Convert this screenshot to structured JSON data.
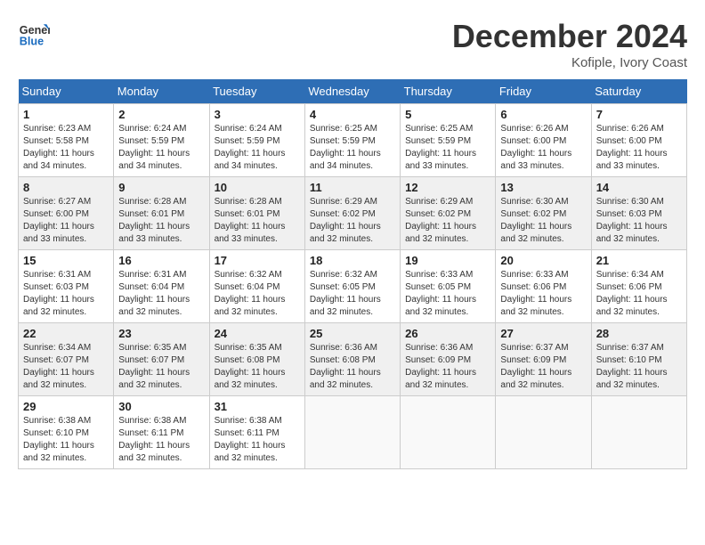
{
  "header": {
    "logo_text_general": "General",
    "logo_text_blue": "Blue",
    "month_title": "December 2024",
    "location": "Kofiple, Ivory Coast"
  },
  "weekdays": [
    "Sunday",
    "Monday",
    "Tuesday",
    "Wednesday",
    "Thursday",
    "Friday",
    "Saturday"
  ],
  "weeks": [
    [
      {
        "day": "1",
        "info": "Sunrise: 6:23 AM\nSunset: 5:58 PM\nDaylight: 11 hours\nand 34 minutes."
      },
      {
        "day": "2",
        "info": "Sunrise: 6:24 AM\nSunset: 5:59 PM\nDaylight: 11 hours\nand 34 minutes."
      },
      {
        "day": "3",
        "info": "Sunrise: 6:24 AM\nSunset: 5:59 PM\nDaylight: 11 hours\nand 34 minutes."
      },
      {
        "day": "4",
        "info": "Sunrise: 6:25 AM\nSunset: 5:59 PM\nDaylight: 11 hours\nand 34 minutes."
      },
      {
        "day": "5",
        "info": "Sunrise: 6:25 AM\nSunset: 5:59 PM\nDaylight: 11 hours\nand 33 minutes."
      },
      {
        "day": "6",
        "info": "Sunrise: 6:26 AM\nSunset: 6:00 PM\nDaylight: 11 hours\nand 33 minutes."
      },
      {
        "day": "7",
        "info": "Sunrise: 6:26 AM\nSunset: 6:00 PM\nDaylight: 11 hours\nand 33 minutes."
      }
    ],
    [
      {
        "day": "8",
        "info": "Sunrise: 6:27 AM\nSunset: 6:00 PM\nDaylight: 11 hours\nand 33 minutes."
      },
      {
        "day": "9",
        "info": "Sunrise: 6:28 AM\nSunset: 6:01 PM\nDaylight: 11 hours\nand 33 minutes."
      },
      {
        "day": "10",
        "info": "Sunrise: 6:28 AM\nSunset: 6:01 PM\nDaylight: 11 hours\nand 33 minutes."
      },
      {
        "day": "11",
        "info": "Sunrise: 6:29 AM\nSunset: 6:02 PM\nDaylight: 11 hours\nand 32 minutes."
      },
      {
        "day": "12",
        "info": "Sunrise: 6:29 AM\nSunset: 6:02 PM\nDaylight: 11 hours\nand 32 minutes."
      },
      {
        "day": "13",
        "info": "Sunrise: 6:30 AM\nSunset: 6:02 PM\nDaylight: 11 hours\nand 32 minutes."
      },
      {
        "day": "14",
        "info": "Sunrise: 6:30 AM\nSunset: 6:03 PM\nDaylight: 11 hours\nand 32 minutes."
      }
    ],
    [
      {
        "day": "15",
        "info": "Sunrise: 6:31 AM\nSunset: 6:03 PM\nDaylight: 11 hours\nand 32 minutes."
      },
      {
        "day": "16",
        "info": "Sunrise: 6:31 AM\nSunset: 6:04 PM\nDaylight: 11 hours\nand 32 minutes."
      },
      {
        "day": "17",
        "info": "Sunrise: 6:32 AM\nSunset: 6:04 PM\nDaylight: 11 hours\nand 32 minutes."
      },
      {
        "day": "18",
        "info": "Sunrise: 6:32 AM\nSunset: 6:05 PM\nDaylight: 11 hours\nand 32 minutes."
      },
      {
        "day": "19",
        "info": "Sunrise: 6:33 AM\nSunset: 6:05 PM\nDaylight: 11 hours\nand 32 minutes."
      },
      {
        "day": "20",
        "info": "Sunrise: 6:33 AM\nSunset: 6:06 PM\nDaylight: 11 hours\nand 32 minutes."
      },
      {
        "day": "21",
        "info": "Sunrise: 6:34 AM\nSunset: 6:06 PM\nDaylight: 11 hours\nand 32 minutes."
      }
    ],
    [
      {
        "day": "22",
        "info": "Sunrise: 6:34 AM\nSunset: 6:07 PM\nDaylight: 11 hours\nand 32 minutes."
      },
      {
        "day": "23",
        "info": "Sunrise: 6:35 AM\nSunset: 6:07 PM\nDaylight: 11 hours\nand 32 minutes."
      },
      {
        "day": "24",
        "info": "Sunrise: 6:35 AM\nSunset: 6:08 PM\nDaylight: 11 hours\nand 32 minutes."
      },
      {
        "day": "25",
        "info": "Sunrise: 6:36 AM\nSunset: 6:08 PM\nDaylight: 11 hours\nand 32 minutes."
      },
      {
        "day": "26",
        "info": "Sunrise: 6:36 AM\nSunset: 6:09 PM\nDaylight: 11 hours\nand 32 minutes."
      },
      {
        "day": "27",
        "info": "Sunrise: 6:37 AM\nSunset: 6:09 PM\nDaylight: 11 hours\nand 32 minutes."
      },
      {
        "day": "28",
        "info": "Sunrise: 6:37 AM\nSunset: 6:10 PM\nDaylight: 11 hours\nand 32 minutes."
      }
    ],
    [
      {
        "day": "29",
        "info": "Sunrise: 6:38 AM\nSunset: 6:10 PM\nDaylight: 11 hours\nand 32 minutes."
      },
      {
        "day": "30",
        "info": "Sunrise: 6:38 AM\nSunset: 6:11 PM\nDaylight: 11 hours\nand 32 minutes."
      },
      {
        "day": "31",
        "info": "Sunrise: 6:38 AM\nSunset: 6:11 PM\nDaylight: 11 hours\nand 32 minutes."
      },
      {
        "day": "",
        "info": ""
      },
      {
        "day": "",
        "info": ""
      },
      {
        "day": "",
        "info": ""
      },
      {
        "day": "",
        "info": ""
      }
    ]
  ]
}
